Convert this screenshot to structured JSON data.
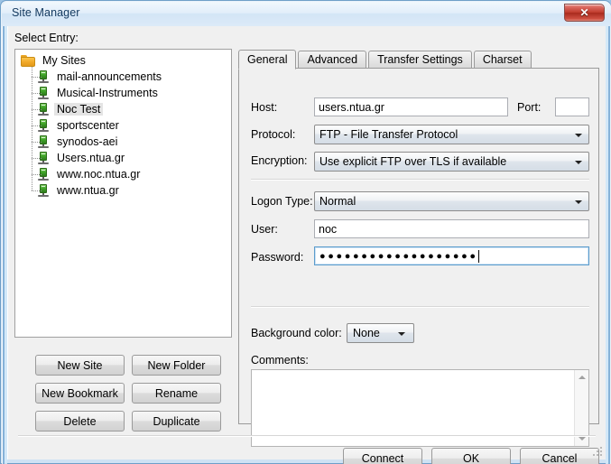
{
  "window": {
    "title": "Site Manager",
    "close_label": "✕"
  },
  "left_panel": {
    "select_entry_label": "Select Entry:",
    "tree": {
      "root": "My Sites",
      "selected": "Noc Test",
      "items": [
        "mail-announcements",
        "Musical-Instruments",
        "Noc Test",
        "sportscenter",
        "synodos-aei",
        "Users.ntua.gr",
        "www.noc.ntua.gr",
        "www.ntua.gr"
      ]
    },
    "buttons": {
      "new_site": "New Site",
      "new_folder": "New Folder",
      "new_bookmark": "New Bookmark",
      "rename": "Rename",
      "delete": "Delete",
      "duplicate": "Duplicate"
    }
  },
  "right_panel": {
    "tabs": [
      {
        "label": "General",
        "active": true
      },
      {
        "label": "Advanced",
        "active": false
      },
      {
        "label": "Transfer Settings",
        "active": false
      },
      {
        "label": "Charset",
        "active": false
      }
    ],
    "general": {
      "host_label": "Host:",
      "host_value": "users.ntua.gr",
      "host_placeholder": "",
      "port_label": "Port:",
      "port_value": "",
      "port_placeholder": "",
      "protocol_label": "Protocol:",
      "protocol_value": "FTP - File Transfer Protocol",
      "encryption_label": "Encryption:",
      "encryption_value": "Use explicit FTP over TLS if available",
      "logon_type_label": "Logon Type:",
      "logon_type_value": "Normal",
      "user_label": "User:",
      "user_value": "noc",
      "user_placeholder": "",
      "password_label": "Password:",
      "password_masked": "●●●●●●●●●●●●●●●●●●●",
      "password_focused": true,
      "background_color_label": "Background color:",
      "background_color_value": "None",
      "comments_label": "Comments:",
      "comments_value": ""
    }
  },
  "dialog_buttons": {
    "connect": "Connect",
    "ok": "OK",
    "cancel": "Cancel"
  },
  "colors": {
    "accent": "#5c9ccc",
    "dialog_face": "#f0f0f0",
    "close_red": "#bf3a2c",
    "folder_yellow": "#f0a828",
    "server_green": "#41a62a"
  }
}
